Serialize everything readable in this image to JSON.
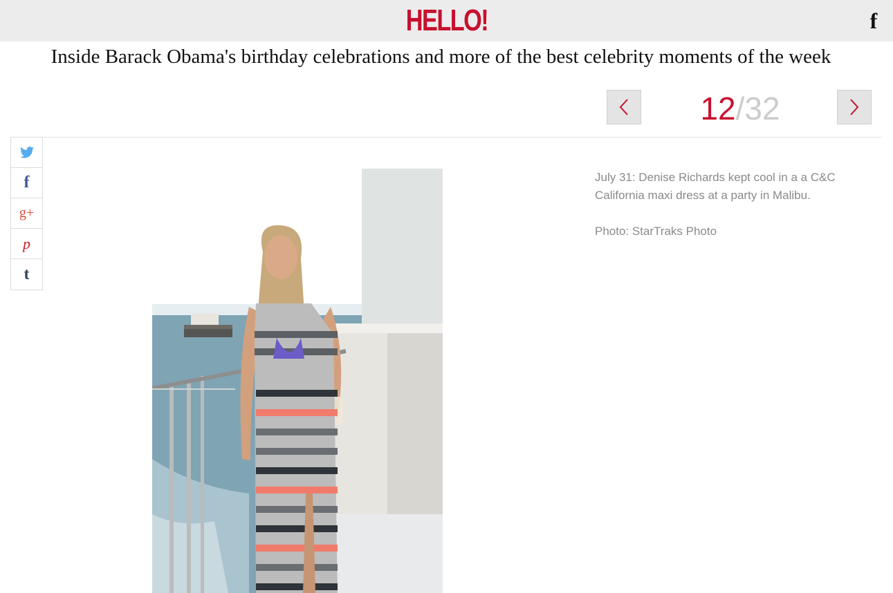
{
  "header": {
    "logo_text": "HELLO!",
    "facebook_icon": "facebook-icon"
  },
  "article": {
    "title": "Inside Barack Obama's birthday celebrations and more of the best celebrity moments of the week"
  },
  "gallery": {
    "current": "12",
    "separator": "/",
    "total": "32",
    "prev_icon": "chevron-left-icon",
    "next_icon": "chevron-right-icon",
    "caption": "July 31: Denise Richards kept cool in a a C&C California maxi dress at a party in Malibu.",
    "credit": "Photo: StarTraks Photo"
  },
  "share": [
    {
      "name": "twitter-icon",
      "color": "#55acee"
    },
    {
      "name": "facebook-icon",
      "color": "#3b5998"
    },
    {
      "name": "google-plus-icon",
      "color": "#dd4b39"
    },
    {
      "name": "pinterest-icon",
      "color": "#cb2027"
    },
    {
      "name": "tumblr-icon",
      "color": "#35465c"
    }
  ],
  "colors": {
    "brand": "#c8102e",
    "topbar": "#ececec",
    "caption_text": "#8a8a8a"
  }
}
